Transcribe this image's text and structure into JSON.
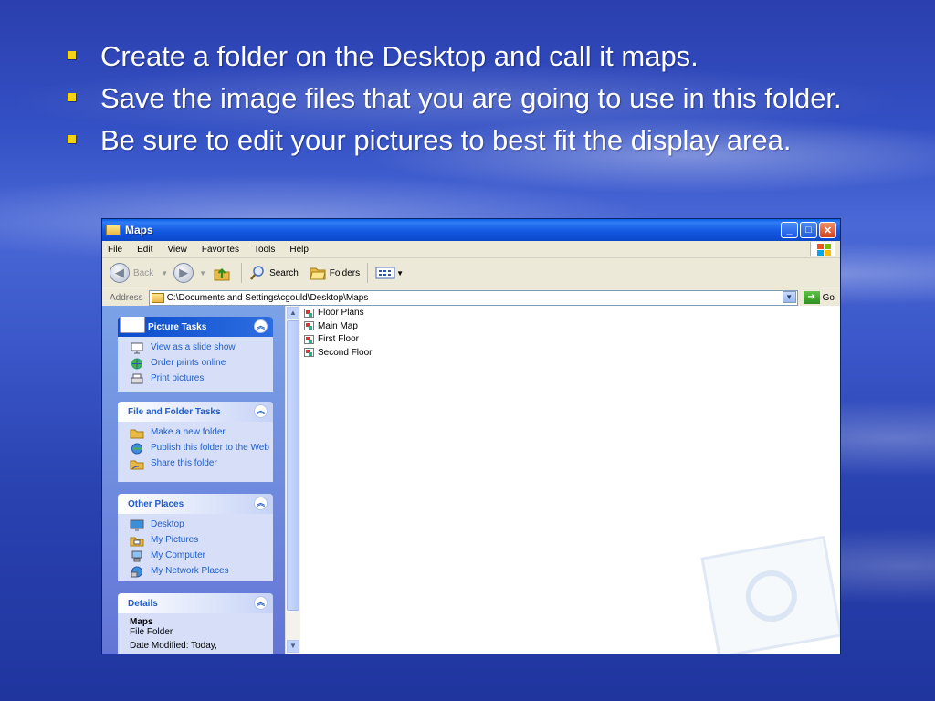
{
  "slide": {
    "bullets": [
      "Create a folder on the Desktop and call it maps.",
      "Save the image files that you are going to use in this folder.",
      "Be sure to edit your pictures to best fit the display area."
    ]
  },
  "window": {
    "title": "Maps",
    "menu": [
      "File",
      "Edit",
      "View",
      "Favorites",
      "Tools",
      "Help"
    ],
    "toolbar": {
      "back_label": "Back",
      "search_label": "Search",
      "folders_label": "Folders"
    },
    "address": {
      "label": "Address",
      "value": "C:\\Documents and Settings\\cgould\\Desktop\\Maps",
      "go_label": "Go"
    },
    "picture_tasks": {
      "title": "Picture Tasks",
      "items": [
        "View as a slide show",
        "Order prints online",
        "Print pictures"
      ]
    },
    "file_folder_tasks": {
      "title": "File and Folder Tasks",
      "items": [
        "Make a new folder",
        "Publish this folder to the Web",
        "Share this folder"
      ]
    },
    "other_places": {
      "title": "Other Places",
      "items": [
        "Desktop",
        "My Pictures",
        "My Computer",
        "My Network Places"
      ]
    },
    "details": {
      "title": "Details",
      "name": "Maps",
      "type": "File Folder",
      "modified": "Date Modified: Today,"
    },
    "files": [
      "Floor Plans",
      "Main Map",
      "First Floor",
      "Second Floor"
    ]
  },
  "colors": {
    "bullet": "#f3d21a",
    "titlebar": "#0b47c9",
    "task_link": "#215dc6"
  }
}
